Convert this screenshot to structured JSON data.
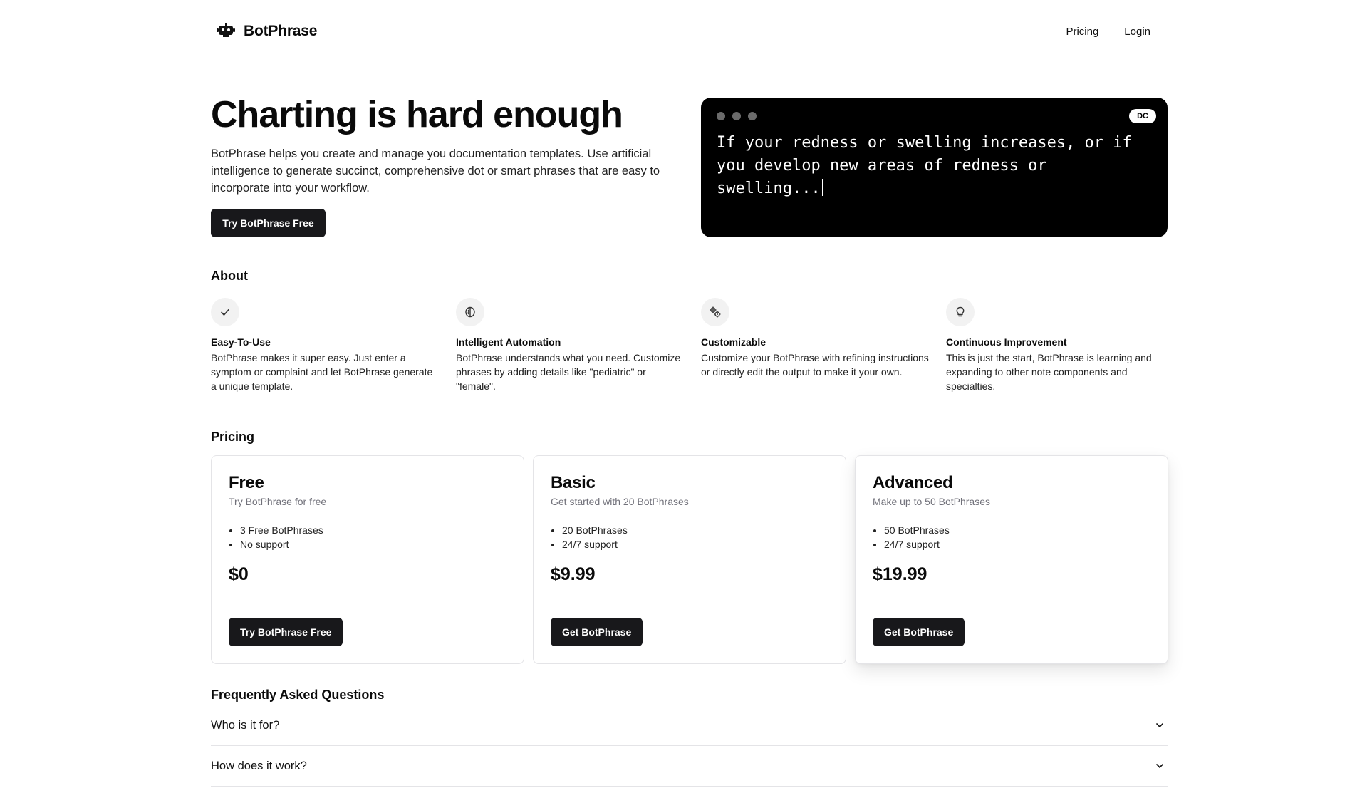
{
  "header": {
    "brand": "BotPhrase",
    "brand_icon": "robot-icon",
    "nav": {
      "pricing": "Pricing",
      "login": "Login"
    }
  },
  "hero": {
    "title": "Charting is hard enough",
    "description": "BotPhrase helps you create and manage you documentation templates. Use artificial intelligence to generate succinct, comprehensive dot or smart phrases that are easy to incorporate into your workflow.",
    "cta": "Try BotPhrase Free",
    "terminal": {
      "badge": "DC",
      "text": "If your redness or swelling increases, or if you develop new areas of redness or swelling..."
    }
  },
  "about": {
    "title": "About",
    "features": [
      {
        "icon": "check-icon",
        "title": "Easy-To-Use",
        "desc": "BotPhrase makes it super easy. Just enter a symptom or complaint and let BotPhrase generate a unique template."
      },
      {
        "icon": "brain-icon",
        "title": "Intelligent Automation",
        "desc": "BotPhrase understands what you need. Customize phrases by adding details like \"pediatric\" or \"female\"."
      },
      {
        "icon": "cogs-icon",
        "title": "Customizable",
        "desc": "Customize your BotPhrase with refining instructions or directly edit the output to make it your own."
      },
      {
        "icon": "lightbulb-icon",
        "title": "Continuous Improvement",
        "desc": "This is just the start, BotPhrase is learning and expanding to other note components and specialties."
      }
    ]
  },
  "pricing": {
    "title": "Pricing",
    "plans": [
      {
        "name": "Free",
        "sub": "Try BotPhrase for free",
        "features": [
          "3 Free BotPhrases",
          "No support"
        ],
        "price": "$0",
        "cta": "Try BotPhrase Free"
      },
      {
        "name": "Basic",
        "sub": "Get started with 20 BotPhrases",
        "features": [
          "20 BotPhrases",
          "24/7 support"
        ],
        "price": "$9.99",
        "cta": "Get BotPhrase"
      },
      {
        "name": "Advanced",
        "sub": "Make up to 50 BotPhrases",
        "features": [
          "50 BotPhrases",
          "24/7 support"
        ],
        "price": "$19.99",
        "cta": "Get BotPhrase"
      }
    ]
  },
  "faq": {
    "title": "Frequently Asked Questions",
    "items": [
      {
        "q": "Who is it for?"
      },
      {
        "q": "How does it work?"
      }
    ]
  }
}
